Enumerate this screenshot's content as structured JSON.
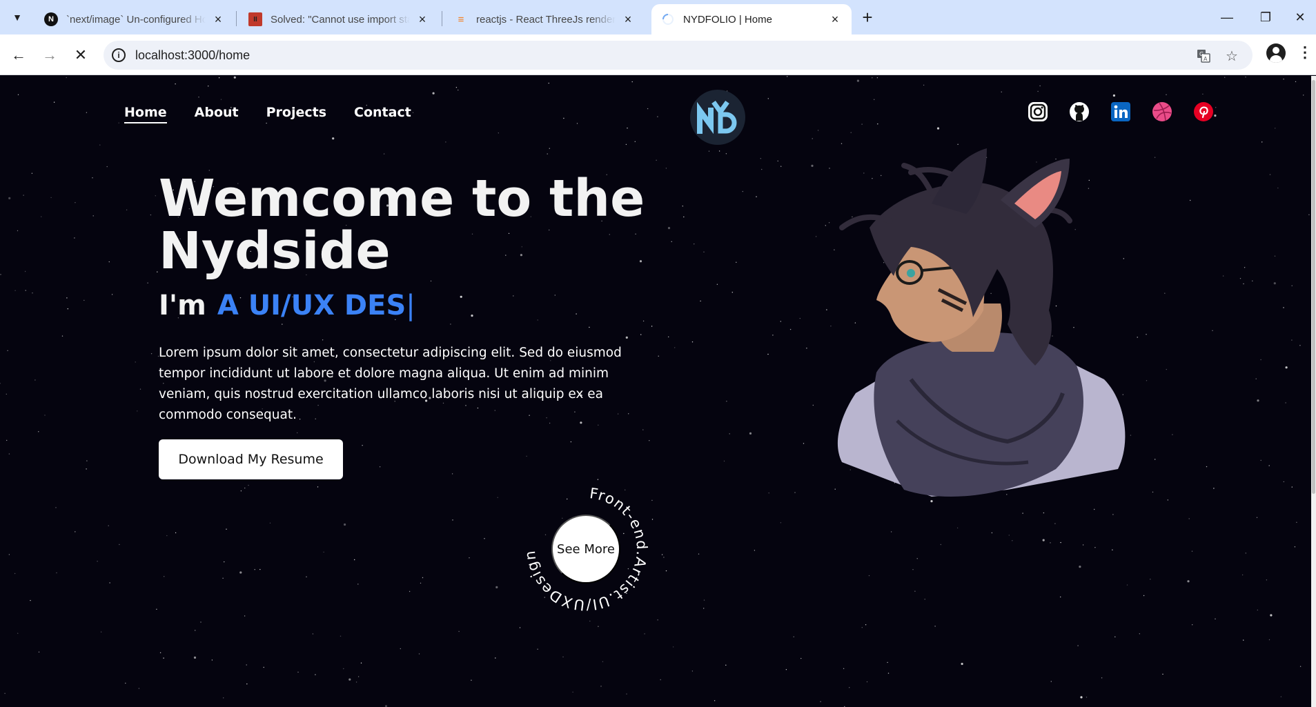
{
  "browser": {
    "tabs": [
      {
        "title": "`next/image` Un-configured Ho",
        "favicon": "N"
      },
      {
        "title": "Solved: \"Cannot use import stat",
        "favicon": "II"
      },
      {
        "title": "reactjs - React ThreeJs render p",
        "favicon": "so"
      },
      {
        "title": "NYDFOLIO | Home",
        "favicon": "loading"
      }
    ],
    "active_tab_index": 3,
    "url": "localhost:3000/home",
    "icons": [
      "tab-search-icon",
      "close-icon",
      "new-tab-icon",
      "minimize-icon",
      "restore-icon",
      "window-close-icon",
      "back-icon",
      "forward-icon",
      "stop-icon",
      "site-info-icon",
      "translate-icon",
      "bookmark-star-icon",
      "profile-icon",
      "menu-icon"
    ]
  },
  "site": {
    "nav": [
      {
        "label": "Home",
        "current": true
      },
      {
        "label": "About",
        "current": false
      },
      {
        "label": "Projects",
        "current": false
      },
      {
        "label": "Contact",
        "current": false
      }
    ],
    "logo_text": "NYD",
    "socials": [
      "instagram-icon",
      "github-icon",
      "linkedin-icon",
      "dribbble-icon",
      "pinterest-icon"
    ],
    "hero": {
      "title": "Wemcome to the Nydside",
      "sub_prefix": "I'm",
      "typed_text": "A UI/UX DES",
      "cursor": "|",
      "body": "Lorem ipsum dolor sit amet, consectetur adipiscing elit. Sed do eiusmod tempor incididunt ut labore et dolore magna aliqua. Ut enim ad minim veniam, quis nostrud exercitation ullamco laboris nisi ut aliquip ex ea commodo consequat.",
      "cta": "Download My Resume"
    },
    "see_more": {
      "label": "See More",
      "ring_text": "Front-end.Artist.UI/UXDesigner"
    }
  },
  "colors": {
    "chrome_tabstrip": "#d3e3fd",
    "page_bg": "#05040f",
    "accent_blue": "#3b82f6",
    "logo_cyan": "#7cc8f0"
  }
}
